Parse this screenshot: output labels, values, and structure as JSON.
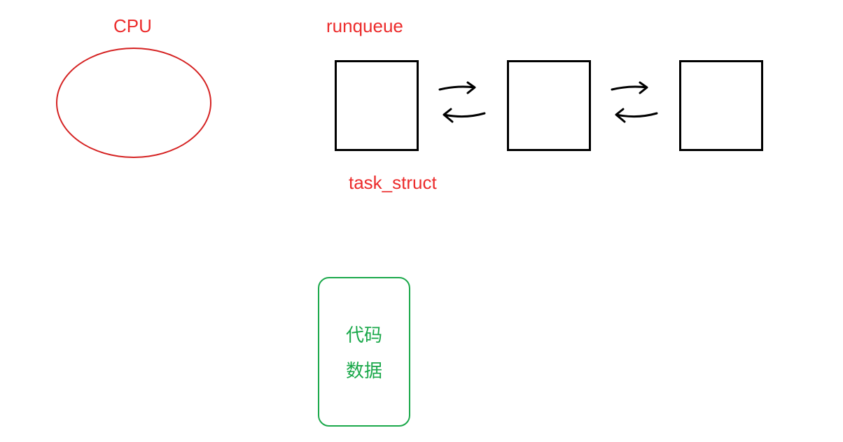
{
  "labels": {
    "cpu": "CPU",
    "runqueue": "runqueue",
    "task_struct": "task_struct"
  },
  "green_box": {
    "line1": "代码",
    "line2": "数据"
  },
  "colors": {
    "red": "#ec2c2c",
    "green": "#1aa84a",
    "black": "#000000"
  },
  "diagram": {
    "description": "CPU scheduling diagram. A CPU (red ellipse) and a runqueue which is a doubly-linked list of three task_struct nodes (black squares) connected by forward and backward arrows. Below is a green process block containing code (代码) and data (数据).",
    "task_nodes": 3
  }
}
